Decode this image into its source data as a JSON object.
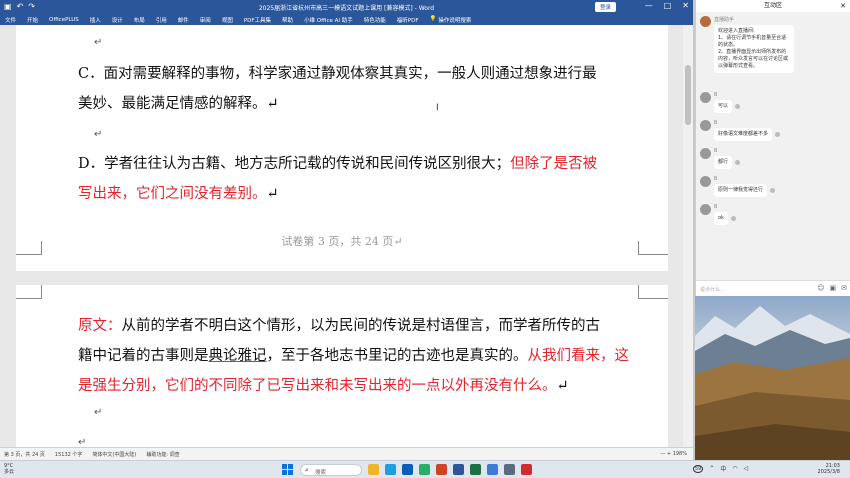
{
  "titlebar": {
    "title": "2025届浙江省杭州市高三一模语文试题上课用 [兼容模式] - Word",
    "login": "登录",
    "min": "—",
    "max": "□",
    "close": "✕",
    "undo": "↶",
    "redo": "↷",
    "save": "▣"
  },
  "ribbon": {
    "tabs": [
      "文件",
      "开始",
      "OfficePLUS",
      "插入",
      "设计",
      "布局",
      "引用",
      "邮件",
      "审阅",
      "视图",
      "PDF工具集",
      "帮助",
      "小维 Office AI 助手",
      "特色功能",
      "福昕PDF"
    ],
    "tell_me": "操作说明搜索",
    "tell_icon": "lightbulb-icon"
  },
  "page1": {
    "para_c": "C．面对需要解释的事物，科学家通过静观体察其真实，一般人则通过想象进行最美妙、最能满足情感的解释。",
    "para_c_line1": "C．面对需要解释的事物，科学家通过静观体察其真实，一般人则通过想象进行最",
    "para_c_line2": "美妙、最能满足情感的解释。↵",
    "para_d_black": "D．学者往往认为古籍、地方志所记载的传说和民间传说区别很大；",
    "para_d_red1": "但除了是否被",
    "para_d_red2": "写出来，它们之间没有差别。",
    "para_d_ret": "↵",
    "return_mark": "↵",
    "footer": "试卷第 3 页，共 24 页↵",
    "cursor": "I"
  },
  "page2": {
    "label": "原文：",
    "line1_black": "从前的学者不明白这个情形，以为民间的传说是村语俚言，而学者所传的古",
    "line2_black_a": "籍中记着的古事则是",
    "line2_underline": "典论雅记",
    "line2_black_b": "，至于各地志书里记的古迹也是真实的。",
    "line2_red": "从我们看来，这",
    "line3_red": "是强生分别，它们的不同除了已写出来和未写出来的一点以外再没有什么。",
    "line3_ret": "↵",
    "return_mark": "↵"
  },
  "statusbar": {
    "page": "第 3 页，共 24 页",
    "words": "15132 个字",
    "lang": "简体中文(中国大陆)",
    "access": "辅助功能: 调查",
    "zoom": "— + 198%"
  },
  "chat": {
    "title": "互动区",
    "close": "✕",
    "host_name": "直播助手",
    "welcome": "欢迎进入直播间:\n1、请在行调节手机音量至合适的状态。\n2、直播界面显示出师所发布的内容，听众发言可以在讨论区或以弹幕形式查看。",
    "messages": [
      {
        "name": "B",
        "text": "可以"
      },
      {
        "name": "B",
        "text": "好像语文难度都差不多"
      },
      {
        "name": "B",
        "text": "都行"
      },
      {
        "name": "B",
        "text": "原则一律我觉得还行"
      },
      {
        "name": "B",
        "text": "ok"
      }
    ],
    "input_placeholder": "说点什么...",
    "input_icons": [
      "smile-icon",
      "image-icon",
      "gift-icon"
    ]
  },
  "taskbar": {
    "weather_temp": "9°C",
    "weather_desc": "多云",
    "search_placeholder": "搜索",
    "search_icon": "search-icon",
    "apps": [
      {
        "name": "file-explorer-icon",
        "color": "#f0b429"
      },
      {
        "name": "edge-icon",
        "color": "#1c9ee0"
      },
      {
        "name": "store-icon",
        "color": "#0a5fb5"
      },
      {
        "name": "wechat-icon",
        "color": "#2aae67"
      },
      {
        "name": "powerpoint-icon",
        "color": "#d04423"
      },
      {
        "name": "word-icon",
        "color": "#2b579a"
      },
      {
        "name": "excel-icon",
        "color": "#1d7044"
      },
      {
        "name": "app-icon",
        "color": "#3c7cd4"
      },
      {
        "name": "app2-icon",
        "color": "#5a6b7d"
      },
      {
        "name": "app3-icon",
        "color": "#d02e2e"
      }
    ],
    "tray_badge": "59",
    "tray_lang": "中",
    "time": "21:03",
    "date": "2025/3/8"
  },
  "colors": {
    "word_blue": "#2b579a",
    "answer_red": "#e0252b"
  }
}
